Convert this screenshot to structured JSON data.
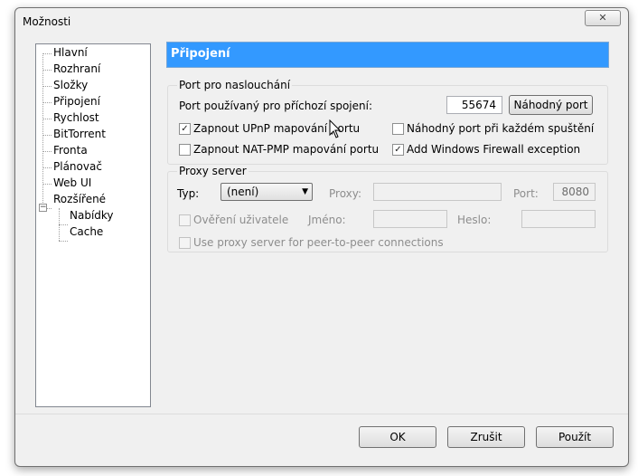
{
  "window": {
    "title": "Možnosti",
    "close_label": "✕"
  },
  "tree": {
    "items": [
      {
        "label": "Hlavní"
      },
      {
        "label": "Rozhraní"
      },
      {
        "label": "Složky"
      },
      {
        "label": "Připojení"
      },
      {
        "label": "Rychlost"
      },
      {
        "label": "BitTorrent"
      },
      {
        "label": "Fronta"
      },
      {
        "label": "Plánovač"
      },
      {
        "label": "Web UI"
      },
      {
        "label": "Rozšířené"
      },
      {
        "label": "Nabídky"
      },
      {
        "label": "Cache"
      }
    ],
    "expander": "−"
  },
  "page": {
    "header": "Připojení"
  },
  "listen": {
    "group_title": "Port pro naslouchání",
    "port_label": "Port používaný pro příchozí spojení:",
    "port_value": "55674",
    "random_port_button": "Náhodný port",
    "upnp": {
      "label": "Zapnout UPnP mapování portu",
      "checked": true
    },
    "natpmp": {
      "label": "Zapnout NAT-PMP mapování portu",
      "checked": false
    },
    "random_each_start": {
      "label": "Náhodný port při každém spuštění",
      "checked": false
    },
    "firewall": {
      "label": "Add Windows Firewall exception",
      "checked": true
    }
  },
  "proxy": {
    "group_title": "Proxy server",
    "type_label": "Typ:",
    "type_value": "(není)",
    "proxy_label": "Proxy:",
    "proxy_value": "",
    "port_label": "Port:",
    "port_value": "8080",
    "auth": {
      "label": "Ověření uživatele",
      "checked": false
    },
    "username_label": "Jméno:",
    "username_value": "",
    "password_label": "Heslo:",
    "password_value": "",
    "p2p": {
      "label": "Use proxy server for peer-to-peer connections",
      "checked": false
    }
  },
  "buttons": {
    "ok": "OK",
    "cancel": "Zrušit",
    "apply": "Použít"
  },
  "icons": {
    "check_glyph": "✓",
    "dropdown_glyph": "▼"
  }
}
